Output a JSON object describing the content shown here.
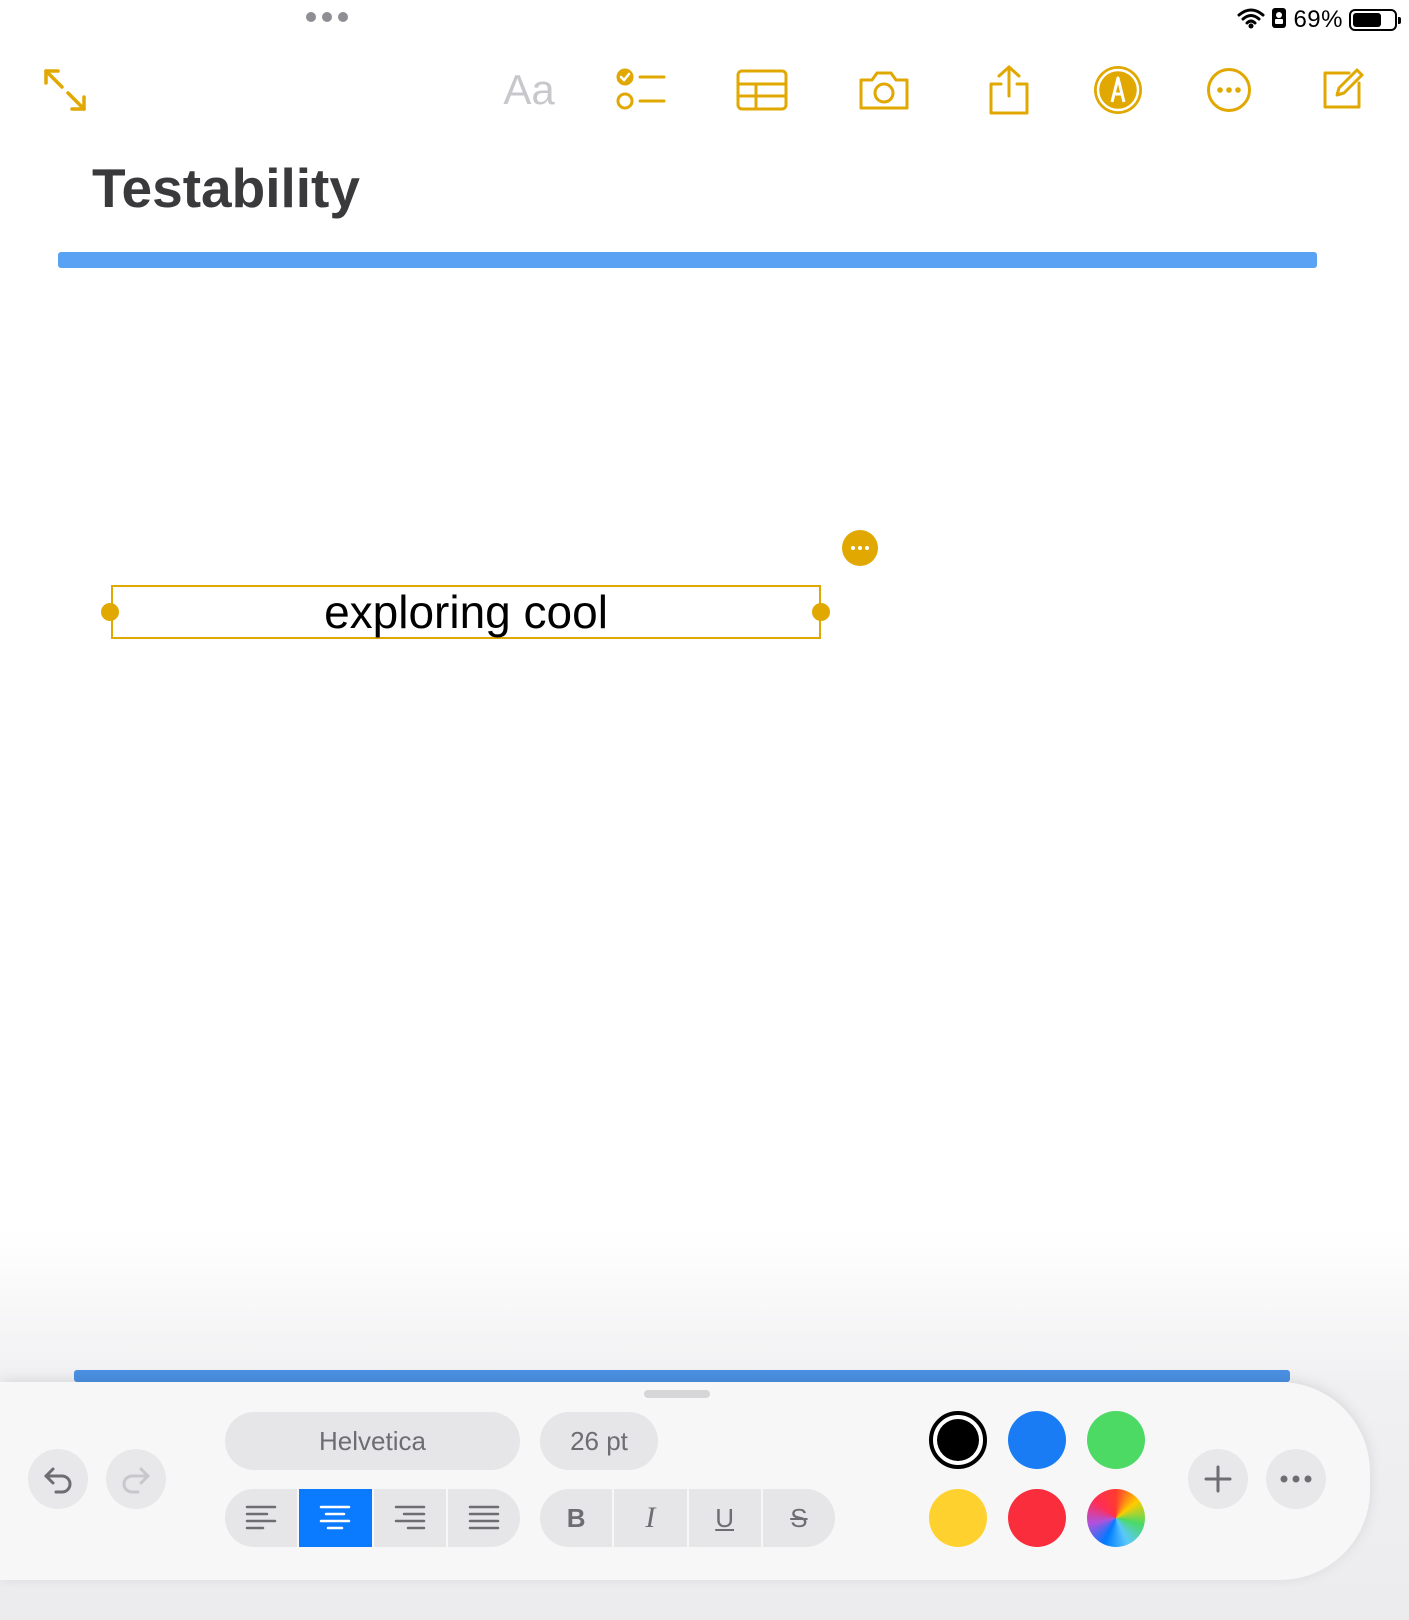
{
  "status_bar": {
    "battery_percent": "69%",
    "battery_level": 0.69
  },
  "toolbar": {
    "format_label": "Aa",
    "accent_color": "#E0A800",
    "icons": [
      "expand-icon",
      "checklist-icon",
      "table-icon",
      "camera-icon",
      "share-icon",
      "markup-icon",
      "more-icon",
      "compose-icon"
    ]
  },
  "note": {
    "title": "Testability",
    "text_box_content": "exploring cool"
  },
  "text_palette": {
    "font_name": "Helvetica",
    "font_size": "26 pt",
    "alignment_selected": "center",
    "style_buttons": {
      "bold": "B",
      "italic": "I",
      "underline": "U",
      "strikethrough": "S"
    },
    "colors": [
      {
        "name": "black",
        "hex": "#000000",
        "selected": true
      },
      {
        "name": "blue",
        "hex": "#1A7CF5"
      },
      {
        "name": "green",
        "hex": "#4CD964"
      },
      {
        "name": "yellow",
        "hex": "#FFD12E"
      },
      {
        "name": "red",
        "hex": "#FA2D3C"
      },
      {
        "name": "multicolor",
        "hex": "conic"
      }
    ]
  }
}
